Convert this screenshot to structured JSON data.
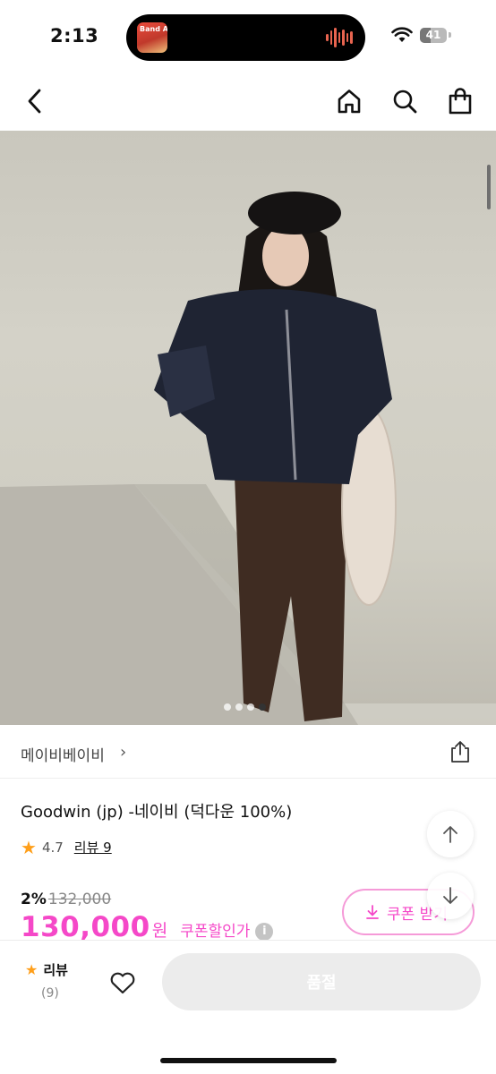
{
  "status_bar": {
    "time": "2:13",
    "now_playing_label": "Band Aid",
    "battery": "41",
    "battery_level": 0.41
  },
  "nav": {
    "back_icon": "chevron-left-icon",
    "home_icon": "home-icon",
    "search_icon": "search-icon",
    "cart_icon": "shopping-bag-icon"
  },
  "gallery": {
    "total_images": 4,
    "active_index": 3
  },
  "product": {
    "brand": "메이비베이비",
    "title": "Goodwin (jp) -네이비 (덕다운 100%)",
    "rating": "4.7",
    "review_link": "리뷰 9",
    "discount": "2%",
    "original_price": "132,000",
    "price": "130,000",
    "currency": "원",
    "coupon_price_label": "쿠폰할인가",
    "coupon_button": "쿠폰 받기"
  },
  "bottom_bar": {
    "review_label": "리뷰",
    "review_count": "(9)",
    "soldout_label": "품절"
  },
  "colors": {
    "accent": "#f548c8",
    "star": "#ff9f1a",
    "disabled_button": "#ececec"
  }
}
